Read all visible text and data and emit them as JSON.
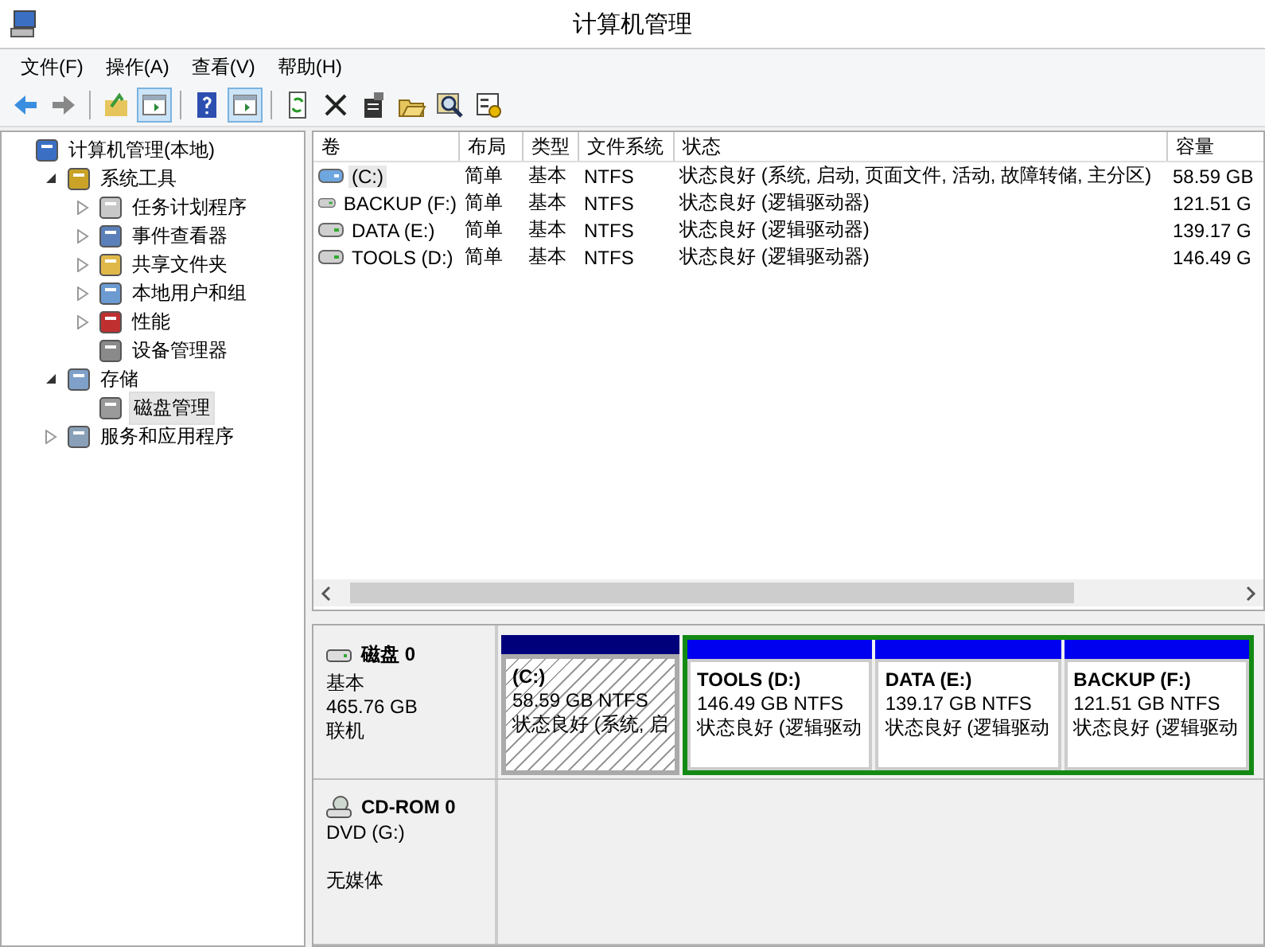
{
  "window": {
    "title": "计算机管理"
  },
  "menu": [
    "文件(F)",
    "操作(A)",
    "查看(V)",
    "帮助(H)"
  ],
  "toolbar": [
    {
      "kind": "button",
      "pressed": false
    },
    {
      "kind": "button",
      "pressed": false
    },
    {
      "kind": "separator"
    },
    {
      "kind": "button",
      "pressed": false
    },
    {
      "kind": "button",
      "pressed": true
    },
    {
      "kind": "separator"
    },
    {
      "kind": "button",
      "pressed": false
    },
    {
      "kind": "button",
      "pressed": true
    },
    {
      "kind": "separator"
    },
    {
      "kind": "button",
      "pressed": false
    },
    {
      "kind": "button",
      "pressed": false
    },
    {
      "kind": "button",
      "pressed": false
    },
    {
      "kind": "button",
      "pressed": false
    },
    {
      "kind": "button",
      "pressed": false
    },
    {
      "kind": "button",
      "pressed": false
    }
  ],
  "tree": [
    {
      "label": "计算机管理(本地)",
      "selected": false,
      "children": [
        {
          "label": "系统工具",
          "expanded": true,
          "selected": false,
          "children": [
            {
              "label": "任务计划程序",
              "expanded": false,
              "selected": false
            },
            {
              "label": "事件查看器",
              "expanded": false,
              "selected": false
            },
            {
              "label": "共享文件夹",
              "expanded": false,
              "selected": false
            },
            {
              "label": "本地用户和组",
              "expanded": false,
              "selected": false
            },
            {
              "label": "性能",
              "expanded": false,
              "selected": false
            },
            {
              "label": "设备管理器",
              "selected": false
            }
          ]
        },
        {
          "label": "存储",
          "expanded": true,
          "selected": false,
          "children": [
            {
              "label": "磁盘管理",
              "selected": true
            }
          ]
        },
        {
          "label": "服务和应用程序",
          "expanded": false,
          "selected": false
        }
      ]
    }
  ],
  "table": {
    "columns": [
      "卷",
      "布局",
      "类型",
      "文件系统",
      "状态",
      "容量"
    ],
    "rows": [
      {
        "cells": [
          "(C:)",
          "简单",
          "基本",
          "NTFS",
          "状态良好 (系统, 启动, 页面文件, 活动, 故障转储, 主分区)",
          "58.59 GB"
        ],
        "system": true,
        "selected": true
      },
      {
        "cells": [
          "BACKUP (F:)",
          "简单",
          "基本",
          "NTFS",
          "状态良好 (逻辑驱动器)",
          "121.51 G"
        ],
        "system": false,
        "selected": false
      },
      {
        "cells": [
          "DATA (E:)",
          "简单",
          "基本",
          "NTFS",
          "状态良好 (逻辑驱动器)",
          "139.17 G"
        ],
        "system": false,
        "selected": false
      },
      {
        "cells": [
          "TOOLS (D:)",
          "简单",
          "基本",
          "NTFS",
          "状态良好 (逻辑驱动器)",
          "146.49 G"
        ],
        "system": false,
        "selected": false
      }
    ]
  },
  "disks": [
    {
      "kind": "disk",
      "name": "磁盘 0",
      "lines": [
        "基本",
        "465.76 GB",
        "联机"
      ],
      "partitions": [
        {
          "kind": "primary",
          "name": "(C:)",
          "size": "58.59 GB NTFS",
          "status": "状态良好 (系统, 启"
        },
        {
          "kind": "logical",
          "name": "TOOLS  (D:)",
          "size": "146.49 GB NTFS",
          "status": "状态良好 (逻辑驱动"
        },
        {
          "kind": "logical",
          "name": "DATA  (E:)",
          "size": "139.17 GB NTFS",
          "status": "状态良好 (逻辑驱动"
        },
        {
          "kind": "logical",
          "name": "BACKUP  (F:)",
          "size": "121.51 GB NTFS",
          "status": "状态良好 (逻辑驱动"
        }
      ]
    },
    {
      "kind": "cdrom",
      "name": "CD-ROM 0",
      "lines": [
        "DVD (G:)",
        "无媒体"
      ]
    }
  ]
}
